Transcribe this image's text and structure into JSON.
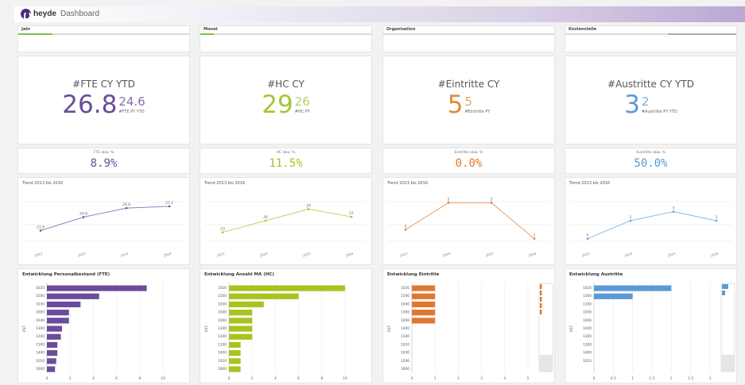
{
  "header": {
    "brand": "heyde",
    "title": "Dashboard"
  },
  "columns": [
    {
      "id": "fte",
      "filter_label": "Jahr",
      "filter_fill": 0.2,
      "filter_color": "#7dc243",
      "kpi_title": "#FTE CY YTD",
      "kpi_main": "26.8",
      "kpi_secondary": "24.6",
      "kpi_sub": "#FTE PY YTD",
      "kpi_color": "#6b4c9a",
      "pct_label": "FTE abw. %",
      "pct_value": "8.9%",
      "accent": "#6b4c9a",
      "trend_title": "Trend 2013 bis 2016",
      "bar_title": "Entwicklung Personalbestand (FTE)"
    },
    {
      "id": "hc",
      "filter_label": "Monat",
      "filter_fill": 0.08,
      "filter_color": "#7dc243",
      "kpi_title": "#HC CY",
      "kpi_main": "29",
      "kpi_secondary": "26",
      "kpi_sub": "#HC PY",
      "kpi_color": "#a4c639",
      "pct_label": "HC abw. %",
      "pct_value": "11.5%",
      "accent": "#a9c21f",
      "trend_title": "Trend 2013 bis 2016",
      "bar_title": "Entwicklung Anzahl MA (HC)"
    },
    {
      "id": "eintritte",
      "filter_label": "Organisation",
      "filter_fill": 0,
      "filter_color": "#7dc243",
      "kpi_title": "#Eintritte CY",
      "kpi_main": "5",
      "kpi_secondary": "5",
      "kpi_sub": "#Eintritte PY",
      "kpi_color": "#e08a3c",
      "pct_label": "Eintritte abw. %",
      "pct_value": "0.0%",
      "accent": "#e0782f",
      "trend_title": "Trend 2013 bis 2016",
      "bar_title": "Entwicklung Eintritte"
    },
    {
      "id": "austritte",
      "filter_label": "Kostenstelle",
      "filter_fill": 0,
      "filter_color": "#aaaaaa",
      "kpi_title": "#Austritte CY YTD",
      "kpi_main": "3",
      "kpi_secondary": "2",
      "kpi_sub": "#Austritte PY YTD",
      "kpi_color": "#5b9bd5",
      "pct_label": "Austritte abw. %",
      "pct_value": "50.0%",
      "accent": "#5b9bd5",
      "trend_title": "Trend 2013 bis 2016",
      "bar_title": "Entwicklung Austritte"
    }
  ],
  "chart_data": [
    {
      "type": "line",
      "x": [
        "2013",
        "2014",
        "2015",
        "2016"
      ],
      "values": [
        21.8,
        24.8,
        26.8,
        27.2
      ],
      "labels": [
        "21.8",
        "24.8",
        "26.8",
        "27.2"
      ],
      "ylim": [
        18,
        30
      ],
      "color": "#6b4c9a"
    },
    {
      "type": "line",
      "x": [
        "2013",
        "2014",
        "2015",
        "2016"
      ],
      "values": [
        23,
        26,
        29,
        27
      ],
      "labels": [
        "23",
        "26",
        "29",
        "27"
      ],
      "ylim": [
        19,
        33
      ],
      "color": "#a9c21f"
    },
    {
      "type": "line",
      "x": [
        "2013",
        "2014",
        "2015",
        "2016"
      ],
      "values": [
        2,
        5,
        5,
        1
      ],
      "labels": [
        "2",
        "5",
        "5",
        "1"
      ],
      "ylim": [
        0,
        6
      ],
      "color": "#e0782f"
    },
    {
      "type": "line",
      "x": [
        "2013",
        "2014",
        "2015",
        "2016"
      ],
      "values": [
        0,
        2,
        3,
        2
      ],
      "labels": [
        "0",
        "2",
        "3",
        "2"
      ],
      "ylim": [
        -1,
        5
      ],
      "color": "#5b9bd5"
    },
    {
      "type": "bar",
      "orientation": "horizontal",
      "ylabel": "KST",
      "categories": [
        "1020",
        "1500",
        "1030",
        "1000",
        "1040",
        "1300",
        "1200",
        "1100",
        "1400",
        "1010",
        "1600"
      ],
      "values": [
        8.6,
        4.5,
        2.9,
        1.9,
        1.9,
        1.3,
        1.2,
        0.9,
        0.9,
        0.8,
        0.7
      ],
      "xlim": [
        0,
        10
      ],
      "xticks": [
        "0",
        "2",
        "4",
        "6",
        "8",
        "10"
      ],
      "color": "#6b4c9a"
    },
    {
      "type": "bar",
      "orientation": "horizontal",
      "ylabel": "KST",
      "categories": [
        "1020",
        "1500",
        "1030",
        "1040",
        "1000",
        "1300",
        "1200",
        "1100",
        "1400",
        "1010",
        "1600"
      ],
      "values": [
        10,
        6,
        3,
        2,
        2,
        2,
        2,
        1,
        1,
        1,
        1
      ],
      "xlim": [
        0,
        10
      ],
      "xticks": [
        "0",
        "2",
        "4",
        "6",
        "8",
        "10"
      ],
      "color": "#a9c21f"
    },
    {
      "type": "bar",
      "orientation": "horizontal",
      "ylabel": "KST",
      "categories": [
        "1020",
        "1500",
        "1040",
        "1300",
        "1000",
        "1400",
        "1100",
        "1010",
        "1030",
        "1200",
        "1600"
      ],
      "values": [
        1,
        1,
        1,
        1,
        1,
        0,
        0,
        0,
        0,
        0,
        0
      ],
      "xlim": [
        0,
        5
      ],
      "xticks": [
        "0",
        "1",
        "2",
        "3",
        "4",
        "5"
      ],
      "color": "#e0782f"
    },
    {
      "type": "bar",
      "orientation": "horizontal",
      "ylabel": "KST",
      "categories": [
        "1020",
        "1500",
        "1100",
        "1030",
        "1000",
        "1040",
        "1300",
        "1200",
        "1400",
        "1010"
      ],
      "values": [
        2,
        1,
        0,
        0,
        0,
        0,
        0,
        0,
        0,
        0
      ],
      "xlim": [
        0,
        3
      ],
      "xticks": [
        "0",
        "0.5",
        "1",
        "1.5",
        "2",
        "2.5",
        "3"
      ],
      "color": "#5b9bd5"
    }
  ]
}
